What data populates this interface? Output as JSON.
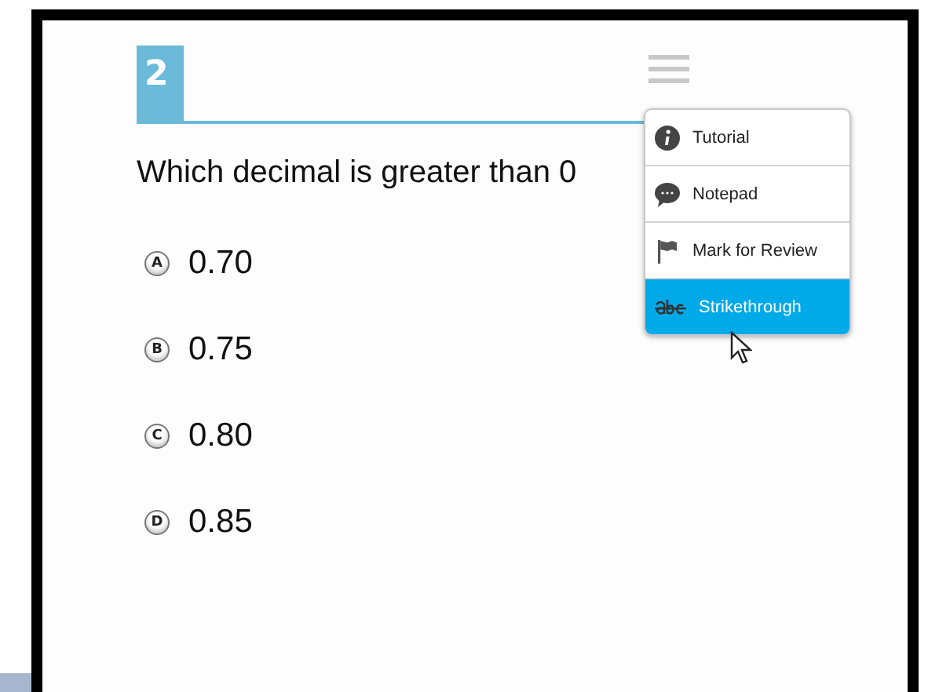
{
  "question": {
    "number": "2",
    "text": "Which decimal is greater than 0"
  },
  "options": [
    {
      "letter": "A",
      "value": "0.70"
    },
    {
      "letter": "B",
      "value": "0.75"
    },
    {
      "letter": "C",
      "value": "0.80"
    },
    {
      "letter": "D",
      "value": "0.85"
    }
  ],
  "menu": {
    "items": [
      {
        "label": "Tutorial",
        "selected": false
      },
      {
        "label": "Notepad",
        "selected": false
      },
      {
        "label": "Mark for Review",
        "selected": false
      },
      {
        "label": "Strikethrough",
        "selected": true
      }
    ]
  }
}
